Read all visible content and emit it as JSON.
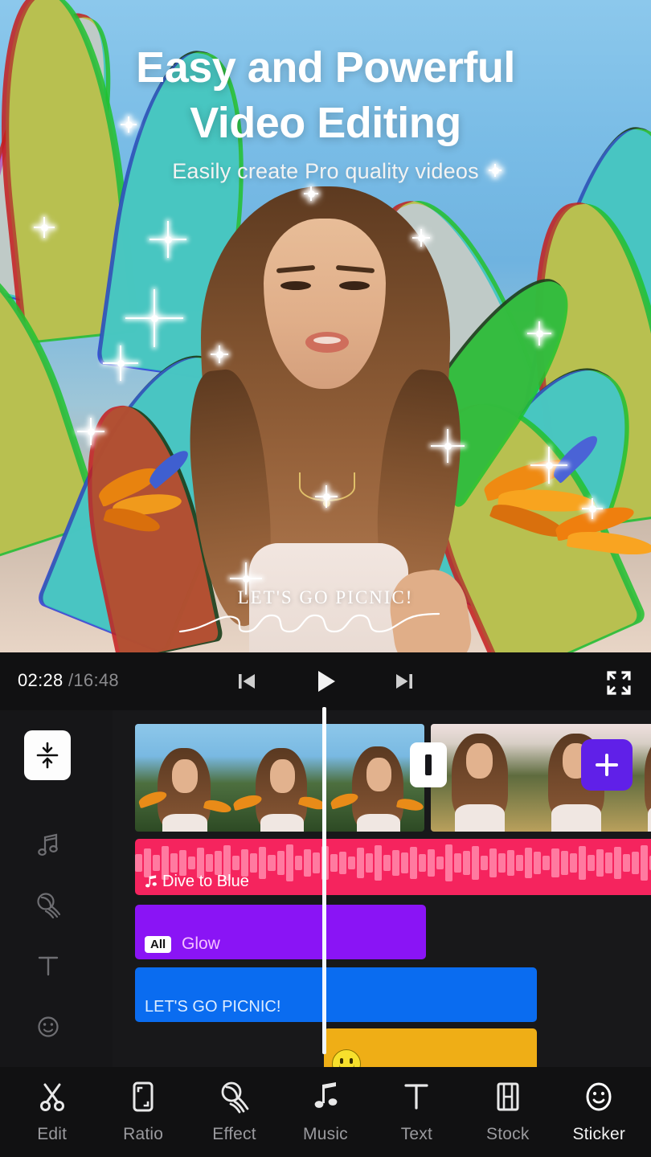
{
  "preview": {
    "headline_line1": "Easy and Powerful",
    "headline_line2": "Video Editing",
    "subtitle": "Easily create Pro quality videos",
    "overlay_caption": "LET'S GO PICNIC!"
  },
  "player": {
    "current_time": "02:28",
    "total_time": "/16:48",
    "prev_label": "prev-frame",
    "play_label": "play",
    "next_label": "next-frame",
    "fullscreen_label": "fullscreen"
  },
  "timeline": {
    "rail_items": [
      {
        "name": "merge-clips",
        "icon": "merge-icon"
      },
      {
        "name": "music-track",
        "icon": "music-note-icon"
      },
      {
        "name": "effect-track",
        "icon": "effect-icon"
      },
      {
        "name": "text-track",
        "icon": "text-icon"
      },
      {
        "name": "sticker-track",
        "icon": "smiley-icon"
      }
    ],
    "transition_label": "transition",
    "add_clip_label": "+",
    "tracks": {
      "music": {
        "title": "Dive to Blue",
        "color": "#f5245e"
      },
      "effect": {
        "badge": "All",
        "title": "Glow",
        "color": "#8a14f5"
      },
      "text": {
        "title": "LET'S GO PICNIC!",
        "color": "#0a6cf0"
      },
      "sticker": {
        "title": "",
        "color": "#efae16"
      }
    }
  },
  "toolbar": {
    "items": [
      {
        "label": "Edit",
        "icon": "scissors-icon",
        "active": false
      },
      {
        "label": "Ratio",
        "icon": "ratio-icon",
        "active": false
      },
      {
        "label": "Effect",
        "icon": "effect-icon",
        "active": false
      },
      {
        "label": "Music",
        "icon": "music-icon",
        "active": false
      },
      {
        "label": "Text",
        "icon": "text-icon",
        "active": false
      },
      {
        "label": "Stock",
        "icon": "film-icon",
        "active": false
      },
      {
        "label": "Sticker",
        "icon": "sticker-icon",
        "active": true
      }
    ]
  },
  "colors": {
    "accent_purple": "#6020e8",
    "music_pink": "#f5245e",
    "effect_purple": "#8a14f5",
    "text_blue": "#0a6cf0",
    "sticker_amber": "#efae16",
    "panel_dark": "#18181a"
  }
}
